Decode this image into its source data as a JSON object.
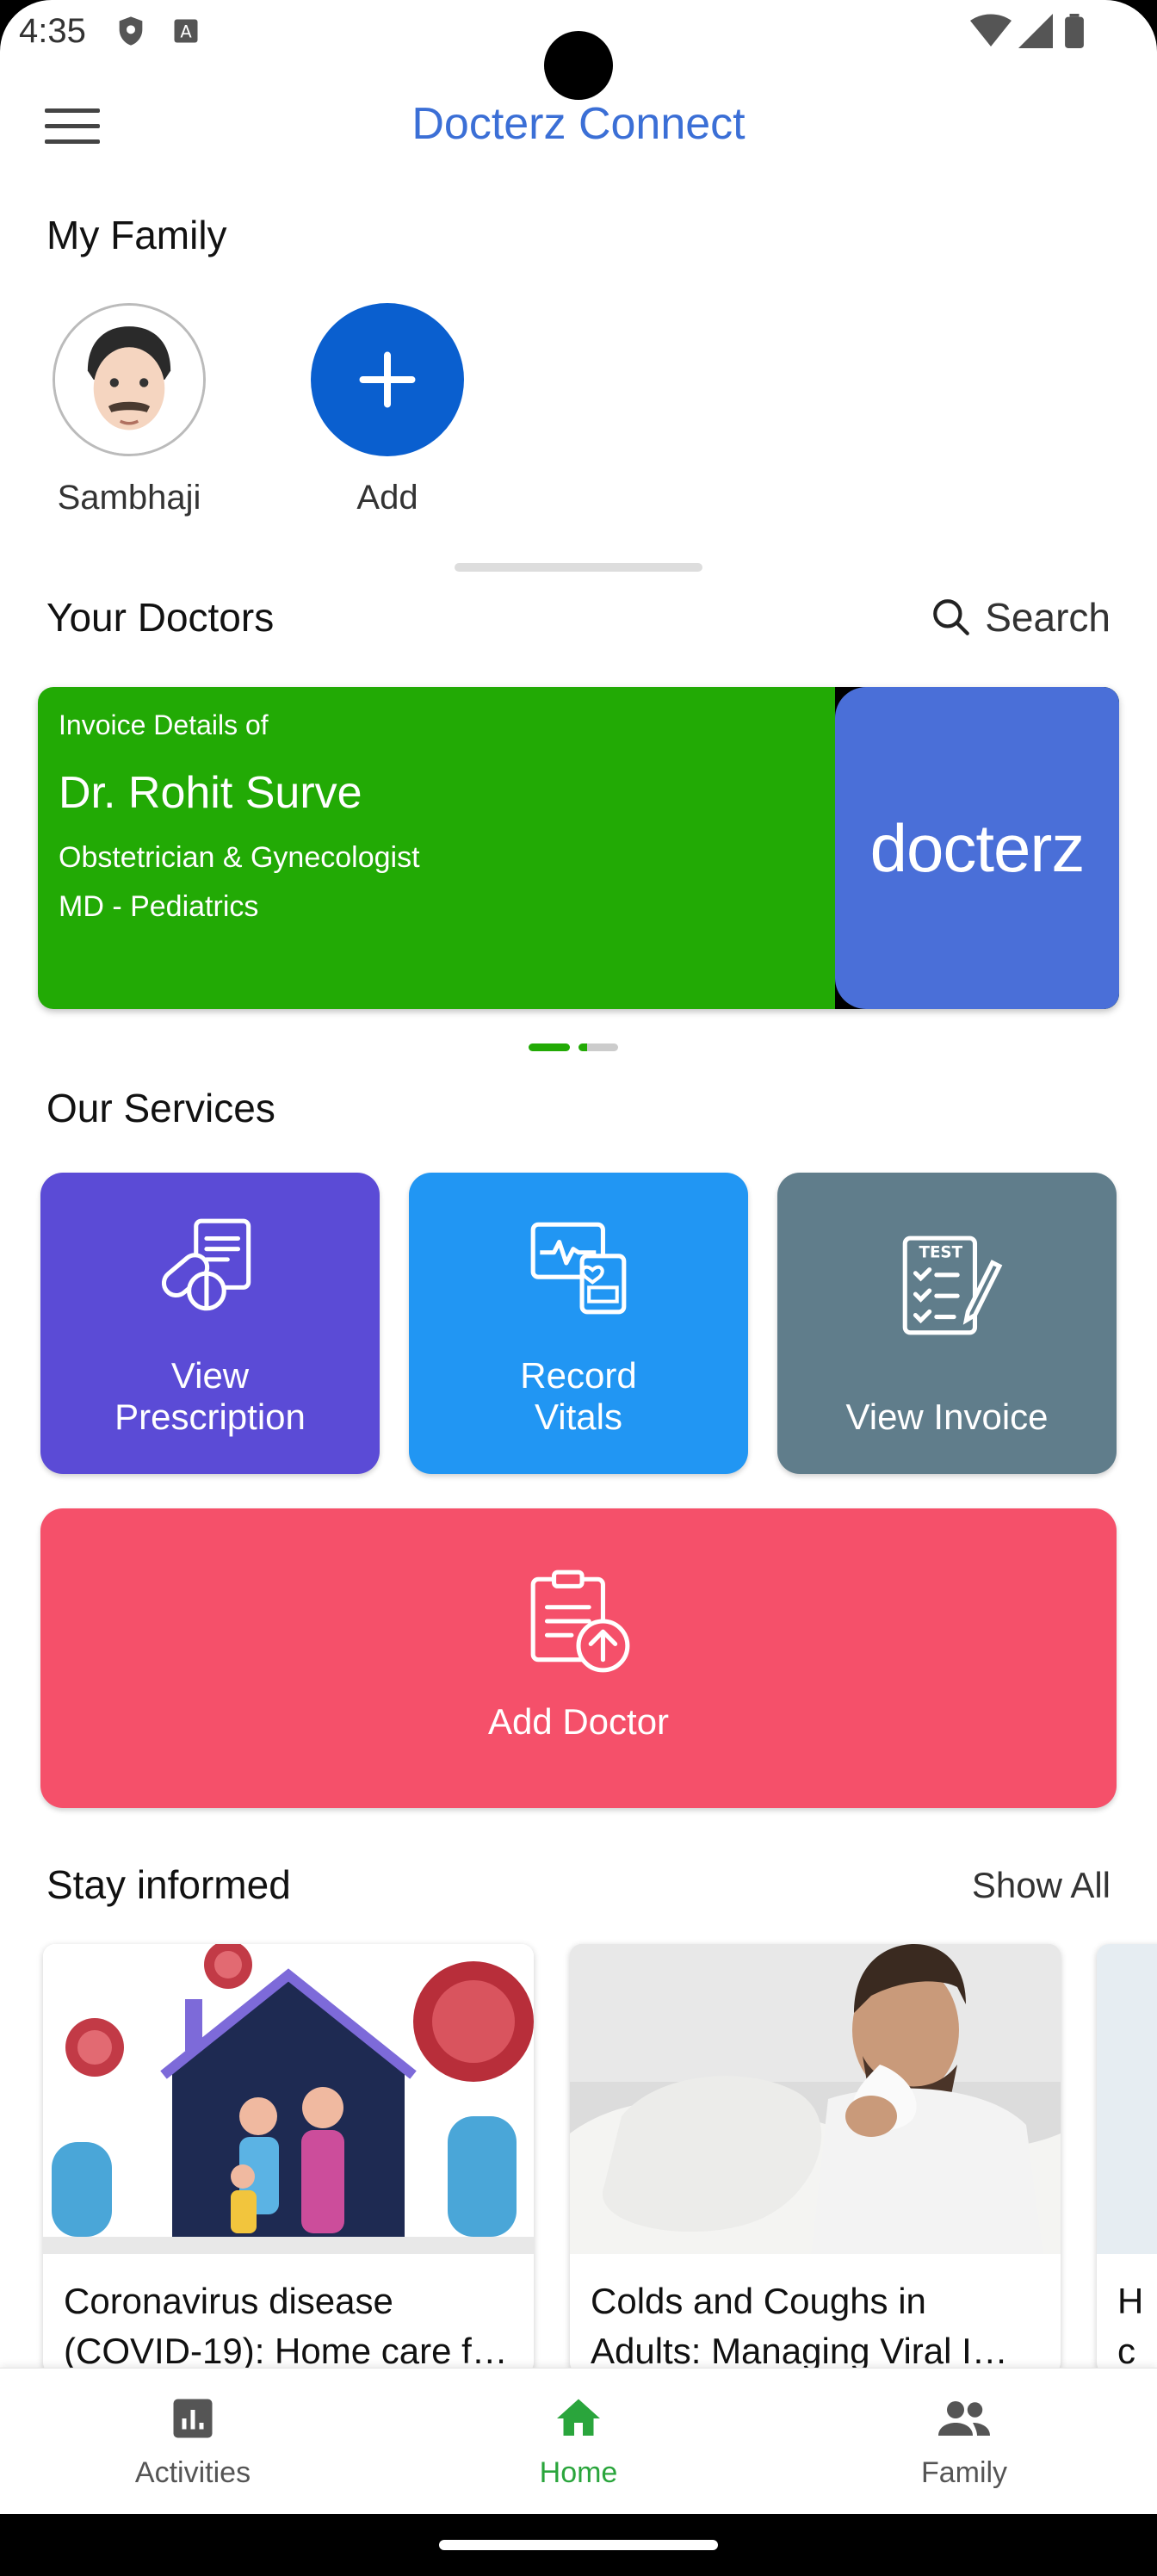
{
  "status_bar": {
    "time": "4:35",
    "icons": [
      "shield-icon",
      "a-box-icon",
      "wifi-icon",
      "signal-icon",
      "battery-icon"
    ]
  },
  "app_bar": {
    "title": "Docterz Connect",
    "menu_icon": "hamburger-menu-icon"
  },
  "family": {
    "title": "My Family",
    "members": [
      {
        "name": "Sambhaji",
        "avatar": "man-face-avatar"
      }
    ],
    "add_label": "Add"
  },
  "doctors": {
    "title": "Your Doctors",
    "search_label": "Search",
    "card": {
      "subtitle": "Invoice Details of",
      "name": "Dr. Rohit Surve",
      "speciality": "Obstetrician & Gynecologist",
      "degree": "MD - Pediatrics",
      "logo_text": "docterz",
      "bg_color": "#22aa05"
    },
    "carousel": {
      "pages": 2,
      "active_page": 1
    }
  },
  "services": {
    "title": "Our Services",
    "items": [
      {
        "label": "View\nPrescription",
        "icon": "prescription-pills-icon",
        "color": "#5b4bd6"
      },
      {
        "label": "Record\nVitals",
        "icon": "heart-monitor-icon",
        "color": "#2196f3"
      },
      {
        "label": "View Invoice",
        "icon": "test-checklist-icon",
        "color": "#607d8b"
      },
      {
        "label": "Add Doctor",
        "icon": "clipboard-upload-icon",
        "color": "#f5506a"
      }
    ]
  },
  "articles": {
    "title": "Stay informed",
    "show_all": "Show All",
    "items": [
      {
        "line1": "Coronavirus disease",
        "line2": "(COVID-19): Home care f…"
      },
      {
        "line1": "Colds and Coughs in",
        "line2": "Adults: Managing Viral I…"
      },
      {
        "line1": "H",
        "line2": "c"
      }
    ]
  },
  "bottom_nav": {
    "items": [
      {
        "label": "Activities",
        "icon": "bar-chart-icon"
      },
      {
        "label": "Home",
        "icon": "home-icon"
      },
      {
        "label": "Family",
        "icon": "people-icon"
      }
    ],
    "active": "Home",
    "active_color": "#2aa53c"
  }
}
